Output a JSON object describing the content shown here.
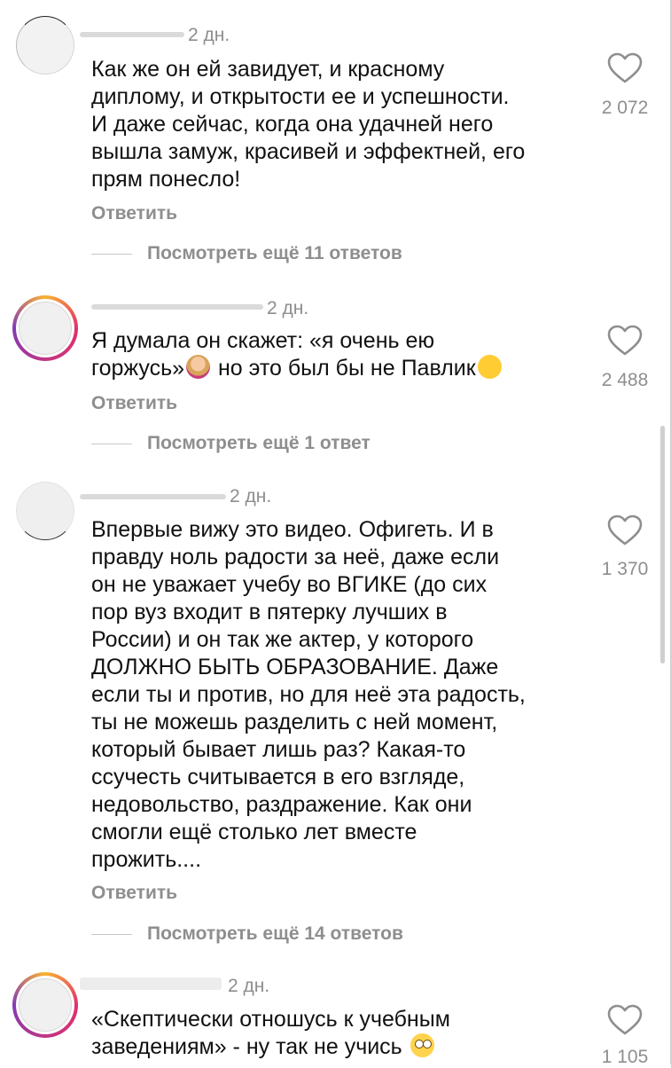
{
  "comments": [
    {
      "time": "2 дн.",
      "text": "Как же он ей завидует, и красному\nдипломy, и открытости ее и успешности.\nИ даже сейчас, когда она удачней него\nвышла замуж, красивей и эффектней, его\nпрям понесло!",
      "reply_label": "Ответить",
      "view_replies": "Посмотреть ещё 11 ответов",
      "likes": "2 072"
    },
    {
      "time": "2 дн.",
      "text_part1": "Я думала он скажет: «я очень ею\nгоржусь»",
      "text_part2": " но это был бы не Павлик",
      "reply_label": "Ответить",
      "view_replies": "Посмотреть ещё 1 ответ",
      "likes": "2 488"
    },
    {
      "time": "2 дн.",
      "text": "Впервые вижу это видео. Офигеть. И в\nправду ноль радости за неё, даже если\nон не уважает учебу во ВГИКЕ (до сих\nпор вуз входит в пятерку лучших в\nРоссии) и он так же актер, у которого\nДОЛЖНО БЫТЬ ОБРАЗОВАНИЕ. Даже\nесли ты и против, но для неё эта радость,\nты не можешь разделить с ней момент,\nкоторый бывает лишь раз? Какая-то\nссучесть считывается в его взгляде,\nнедовольство, раздражение. Как они\nсмогли ещё столько лет вместе\nпрожить....",
      "reply_label": "Ответить",
      "view_replies": "Посмотреть ещё 14 ответов",
      "likes": "1 370"
    },
    {
      "time": "2 дн.",
      "text": "«Скептически отношусь к учебным\nзаведениям» - ну так не учись",
      "likes": "1 105"
    }
  ],
  "icons": {
    "like": "heart-outline-icon",
    "emoji_1": "woman-facepalming-emoji",
    "emoji_2": "rolling-on-floor-laughing-emoji",
    "emoji_3": "face-with-rolling-eyes-emoji"
  },
  "colors": {
    "text": "#111111",
    "secondary": "#8e8e8e",
    "story_ring_start": "#f9b233",
    "story_ring_mid": "#e1306c",
    "story_ring_end": "#833ab4"
  }
}
